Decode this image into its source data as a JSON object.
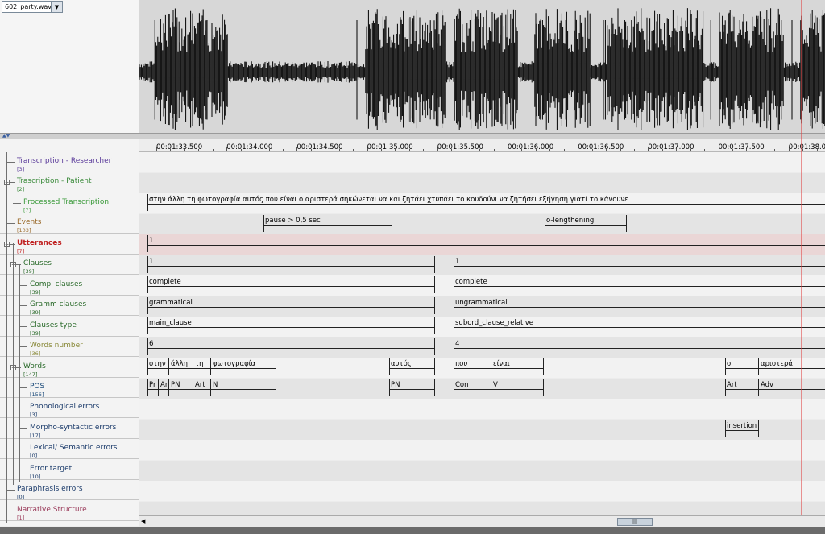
{
  "file": {
    "name": "602_party.wav",
    "dropdown_icon": "triangle-down-icon"
  },
  "timeline": {
    "labels": [
      "00:01:33.500",
      "00:01:34.000",
      "00:01:34.500",
      "00:01:35.000",
      "00:01:35.500",
      "00:01:36.000",
      "00:01:36.500",
      "00:01:37.000",
      "00:01:37.500",
      "00:01:38.0"
    ]
  },
  "tiers": [
    {
      "label": "Transcription - Researcher",
      "count": "[3]",
      "color": "#5a3a9a"
    },
    {
      "label": "Trascription - Patient",
      "count": "[2]",
      "color": "#3a8a3a"
    },
    {
      "label": "Processed Transcription",
      "count": "[7]",
      "color": "#3a9a3a"
    },
    {
      "label": "Events",
      "count": "[103]",
      "color": "#9a6a2a"
    },
    {
      "label": "Utterances",
      "count": "[7]",
      "color": "#c02020"
    },
    {
      "label": "Clauses",
      "count": "[39]",
      "color": "#2a6a2a"
    },
    {
      "label": "Compl clauses",
      "count": "[39]",
      "color": "#2a6a2a"
    },
    {
      "label": "Gramm clauses",
      "count": "[39]",
      "color": "#2a6a2a"
    },
    {
      "label": "Clauses type",
      "count": "[39]",
      "color": "#2a6a2a"
    },
    {
      "label": "Words number",
      "count": "[36]",
      "color": "#8a8a3a"
    },
    {
      "label": "Words",
      "count": "[147]",
      "color": "#2a6a2a"
    },
    {
      "label": "POS",
      "count": "[156]",
      "color": "#1a4a7a"
    },
    {
      "label": "Phonological errors",
      "count": "[3]",
      "color": "#1a3a6a"
    },
    {
      "label": "Morpho-syntactic errors",
      "count": "[17]",
      "color": "#1a3a6a"
    },
    {
      "label": "Lexical/ Semantic errors",
      "count": "[0]",
      "color": "#1a3a6a"
    },
    {
      "label": "Error target",
      "count": "[10]",
      "color": "#1a3a6a"
    },
    {
      "label": "Paraphrasis errors",
      "count": "[0]",
      "color": "#1a3a6a"
    },
    {
      "label": "Narrative Structure",
      "count": "[1]",
      "color": "#9a3a5a"
    }
  ],
  "annotations": {
    "processed": "στην άλλη τη φωτογραφία αυτός που είναι ο αριστερά σηκώνεται να και ζητάει χτυπάει το κουδούνι να ζητήσει εξήγηση γιατί το κάνουνε",
    "events": [
      "pause > 0,5 sec",
      "o-lengthening"
    ],
    "utterance": "1",
    "clauses": [
      "1",
      "1"
    ],
    "compl": [
      "complete",
      "complete"
    ],
    "gramm": [
      "grammatical",
      "ungrammatical"
    ],
    "ctype": [
      "main_clause",
      "subord_clause_relative"
    ],
    "wnum": [
      "6",
      "4"
    ],
    "words": [
      "στην",
      "άλλη",
      "τη",
      "φωτογραφία",
      "αυτός",
      "που",
      "είναι",
      "ο",
      "αριστερά"
    ],
    "pos": [
      "Pr",
      "Ar",
      "PN",
      "Art",
      "N",
      "PN",
      "Con",
      "V",
      "Art",
      "Adv"
    ],
    "morpho": "insertion"
  },
  "scrollbar": {
    "left_icon": "arrow-left-icon",
    "thumb_icon": "grip-icon"
  }
}
